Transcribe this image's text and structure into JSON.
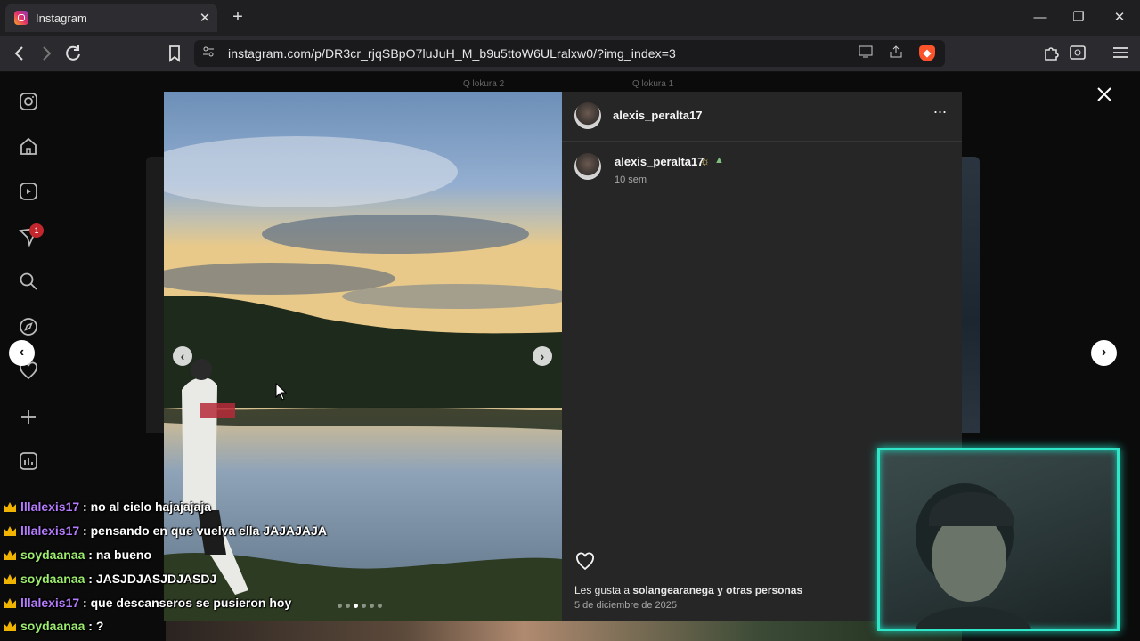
{
  "browser": {
    "tab_title": "Instagram",
    "tab_close": "✕",
    "new_tab": "+",
    "url": "instagram.com/p/DR3cr_rjqSBpO7luJuH_M_b9u5ttoW6ULralxw0/?img_index=3",
    "window_controls": {
      "minimize": "—",
      "maximize": "❐",
      "close": "✕"
    }
  },
  "background_strip": [
    "Q lokura 2",
    "Q lokura 1"
  ],
  "sidebar": {
    "notification_count": "1",
    "icons": [
      "instagram-logo-icon",
      "home-icon",
      "reels-icon",
      "messages-icon",
      "search-icon",
      "explore-icon",
      "notifications-icon",
      "create-icon",
      "dashboard-icon"
    ]
  },
  "post": {
    "author": "alexis_peralta17",
    "caption_author": "alexis_peralta17",
    "caption_emoji_1": "☼",
    "caption_emoji_2": "▲",
    "time_ago": "10 sem",
    "likes_prefix": "Les gusta a ",
    "likes_user": "solangearanega",
    "likes_suffix": " y otras personas",
    "date": "5 de diciembre de 2025",
    "carousel": {
      "total": 6,
      "active_index": 3
    }
  },
  "chat": [
    {
      "user": "lllalexis17",
      "color": "purple",
      "message": " : no al cielo hajajajaja"
    },
    {
      "user": "lllalexis17",
      "color": "purple",
      "message": " : pensando en que vuelva ella JAJAJAJA"
    },
    {
      "user": "soydaanaa",
      "color": "green",
      "message": " : na bueno"
    },
    {
      "user": "soydaanaa",
      "color": "green",
      "message": " : JASJDJASJDJASDJ"
    },
    {
      "user": "lllalexis17",
      "color": "purple",
      "message": " : que descanseros se pusieron hoy"
    },
    {
      "user": "soydaanaa",
      "color": "green",
      "message": " : ?"
    }
  ],
  "colors": {
    "chat_purple": "#b57cff",
    "chat_green": "#9dee6e",
    "cam_border": "#2fe6c8",
    "notif_badge": "#c1272d"
  }
}
